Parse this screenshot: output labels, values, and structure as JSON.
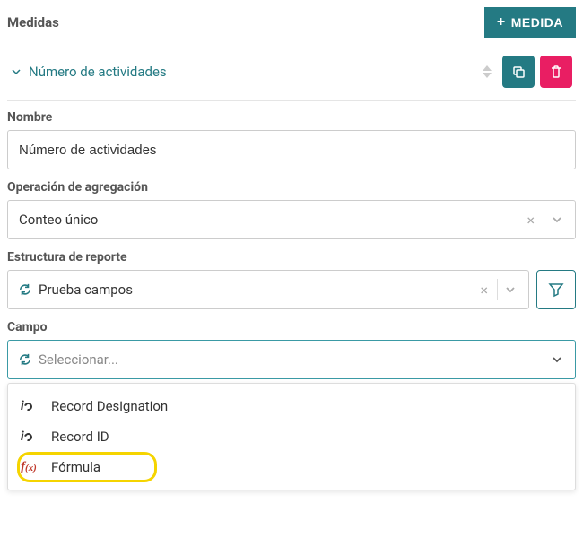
{
  "header": {
    "title": "Medidas",
    "add_button_label": "MEDIDA"
  },
  "collapsible": {
    "title": "Número de actividades"
  },
  "fields": {
    "name": {
      "label": "Nombre",
      "value": "Número de actividades"
    },
    "aggregation": {
      "label": "Operación de agregación",
      "value": "Conteo único"
    },
    "structure": {
      "label": "Estructura de reporte",
      "value": "Prueba campos"
    },
    "campo": {
      "label": "Campo",
      "placeholder": "Seleccionar...",
      "options": [
        {
          "icon": "io",
          "label": "Record Designation"
        },
        {
          "icon": "io",
          "label": "Record ID"
        },
        {
          "icon": "fx",
          "label": "Fórmula",
          "highlighted": true
        }
      ]
    }
  }
}
